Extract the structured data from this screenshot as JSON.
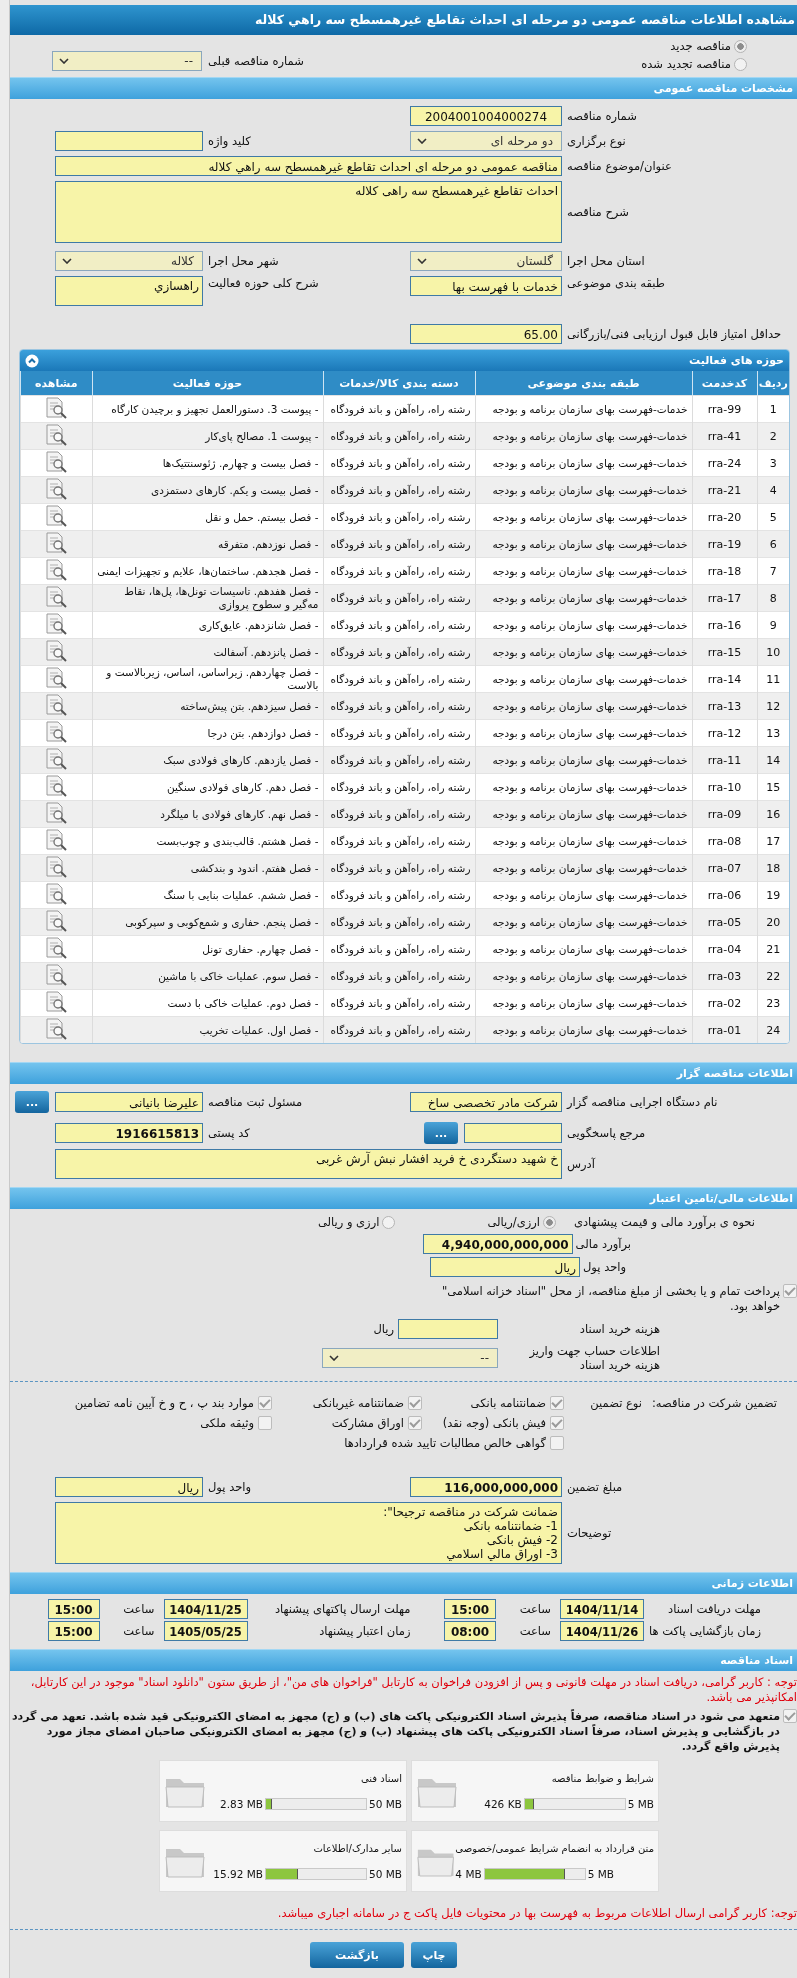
{
  "page_title": "مشاهده اطلاعات مناقصه عمومی دو مرحله ای احداث تقاطع غیرهمسطح سه راهي كلاله",
  "tender_kind": [
    {
      "label": "مناقصه جدید",
      "selected": true
    },
    {
      "label": "مناقصه تجدید شده",
      "selected": false
    }
  ],
  "previous_tender": {
    "label": "شماره مناقصه قبلی",
    "value": "--"
  },
  "general": {
    "heading": "مشخصات مناقصه عمومی",
    "tender_number": {
      "label": "شماره مناقصه",
      "value": "2004001004000274"
    },
    "holding_type": {
      "label": "نوع برگزاری",
      "value": "دو مرحله ای"
    },
    "keyword": {
      "label": "کلید واژه"
    },
    "subject": {
      "label": "عنوان/موضوع مناقصه",
      "value": "مناقصه عمومی دو مرحله ای احداث تقاطع غیرهمسطح سه راهي كلاله"
    },
    "description": {
      "label": "شرح مناقصه",
      "value": "احداث تقاطع غیرهمسطح سه راهی کلاله"
    },
    "province": {
      "label": "استان محل اجرا",
      "value": "گلستان"
    },
    "city": {
      "label": "شهر محل اجرا",
      "value": "کلاله"
    },
    "category": {
      "label": "طبقه بندی موضوعی",
      "value": "خدمات با فهرست بها"
    },
    "activity_scope": {
      "label": "شرح کلی حوزه فعالیت",
      "value": "راهسازي"
    },
    "min_score": {
      "label": "حداقل امتیاز قابل قبول ارزیابی فنی/بازرگانی",
      "value": "65.00"
    }
  },
  "activities": {
    "heading": "حوزه های فعالیت",
    "columns": [
      "ردیف",
      "کدخدمت",
      "طبقه بندی موضوعی",
      "دسته بندی کالا/خدمات",
      "حوزه فعالیت",
      "مشاهده"
    ],
    "rows": [
      {
        "no": "1",
        "code": "rra-99",
        "category": "خدمات-فهرست بهای سازمان برنامه و بودجه",
        "group": "رشته راه، راه‌آهن و باند فرودگاه",
        "activity": "- پیوست 3. دستورالعمل تجهیز و برچیدن کارگاه"
      },
      {
        "no": "2",
        "code": "rra-41",
        "category": "خدمات-فهرست بهای سازمان برنامه و بودجه",
        "group": "رشته راه، راه‌آهن و باند فرودگاه",
        "activity": "- پیوست 1. مصالح پای‌کار"
      },
      {
        "no": "3",
        "code": "rra-24",
        "category": "خدمات-فهرست بهای سازمان برنامه و بودجه",
        "group": "رشته راه، راه‌آهن و باند فرودگاه",
        "activity": "- فصل بیست و چهارم. ژئوسنتتیک‌ها"
      },
      {
        "no": "4",
        "code": "rra-21",
        "category": "خدمات-فهرست بهای سازمان برنامه و بودجه",
        "group": "رشته راه، راه‌آهن و باند فرودگاه",
        "activity": "- فصل بیست و یکم. کارهای دستمزدی"
      },
      {
        "no": "5",
        "code": "rra-20",
        "category": "خدمات-فهرست بهای سازمان برنامه و بودجه",
        "group": "رشته راه، راه‌آهن و باند فرودگاه",
        "activity": "- فصل بیستم. حمل و نقل"
      },
      {
        "no": "6",
        "code": "rra-19",
        "category": "خدمات-فهرست بهای سازمان برنامه و بودجه",
        "group": "رشته راه، راه‌آهن و باند فرودگاه",
        "activity": "- فصل نوزدهم. متفرقه"
      },
      {
        "no": "7",
        "code": "rra-18",
        "category": "خدمات-فهرست بهای سازمان برنامه و بودجه",
        "group": "رشته راه، راه‌آهن و باند فرودگاه",
        "activity": "- فصل هجدهم. ساختمان‌ها، علایم و تجهیزات ایمنی"
      },
      {
        "no": "8",
        "code": "rra-17",
        "category": "خدمات-فهرست بهای سازمان برنامه و بودجه",
        "group": "رشته راه، راه‌آهن و باند فرودگاه",
        "activity": "- فصل هفدهم. تاسیسات تونل‌ها، پل‌ها، نقاط مه‌گیر و سطوح پروازی"
      },
      {
        "no": "9",
        "code": "rra-16",
        "category": "خدمات-فهرست بهای سازمان برنامه و بودجه",
        "group": "رشته راه، راه‌آهن و باند فرودگاه",
        "activity": "- فصل شانزدهم. عایق‌کاری"
      },
      {
        "no": "10",
        "code": "rra-15",
        "category": "خدمات-فهرست بهای سازمان برنامه و بودجه",
        "group": "رشته راه، راه‌آهن و باند فرودگاه",
        "activity": "- فصل پانزدهم. آسفالت"
      },
      {
        "no": "11",
        "code": "rra-14",
        "category": "خدمات-فهرست بهای سازمان برنامه و بودجه",
        "group": "رشته راه، راه‌آهن و باند فرودگاه",
        "activity": "- فصل چهاردهم. زیراساس، اساس، زیربالاست  و بالاست"
      },
      {
        "no": "12",
        "code": "rra-13",
        "category": "خدمات-فهرست بهای سازمان برنامه و بودجه",
        "group": "رشته راه، راه‌آهن و باند فرودگاه",
        "activity": "- فصل سیزدهم. بتن پیش‌ساخته"
      },
      {
        "no": "13",
        "code": "rra-12",
        "category": "خدمات-فهرست بهای سازمان برنامه و بودجه",
        "group": "رشته راه، راه‌آهن و باند فرودگاه",
        "activity": "- فصل دوازدهم. بتن درجا"
      },
      {
        "no": "14",
        "code": "rra-11",
        "category": "خدمات-فهرست بهای سازمان برنامه و بودجه",
        "group": "رشته راه، راه‌آهن و باند فرودگاه",
        "activity": "- فصل یازدهم. کارهای فولادی سبک"
      },
      {
        "no": "15",
        "code": "rra-10",
        "category": "خدمات-فهرست بهای سازمان برنامه و بودجه",
        "group": "رشته راه، راه‌آهن و باند فرودگاه",
        "activity": "- فصل دهم. کارهای فولادی سنگین"
      },
      {
        "no": "16",
        "code": "rra-09",
        "category": "خدمات-فهرست بهای سازمان برنامه و بودجه",
        "group": "رشته راه، راه‌آهن و باند فرودگاه",
        "activity": "- فصل نهم. کارهای فولادی با میلگرد"
      },
      {
        "no": "17",
        "code": "rra-08",
        "category": "خدمات-فهرست بهای سازمان برنامه و بودجه",
        "group": "رشته راه، راه‌آهن و باند فرودگاه",
        "activity": "- فصل هشتم. قالب‌بندی و چوب‌بست"
      },
      {
        "no": "18",
        "code": "rra-07",
        "category": "خدمات-فهرست بهای سازمان برنامه و بودجه",
        "group": "رشته راه، راه‌آهن و باند فرودگاه",
        "activity": "- فصل هفتم. اندود و بندکشی"
      },
      {
        "no": "19",
        "code": "rra-06",
        "category": "خدمات-فهرست بهای سازمان برنامه و بودجه",
        "group": "رشته راه، راه‌آهن و باند فرودگاه",
        "activity": "- فصل ششم. عملیات بنایی با سنگ"
      },
      {
        "no": "20",
        "code": "rra-05",
        "category": "خدمات-فهرست بهای سازمان برنامه و بودجه",
        "group": "رشته راه، راه‌آهن و باند فرودگاه",
        "activity": "- فصل پنجم. حفاری و شمع‌کوبی و سپرکوبی"
      },
      {
        "no": "21",
        "code": "rra-04",
        "category": "خدمات-فهرست بهای سازمان برنامه و بودجه",
        "group": "رشته راه، راه‌آهن و باند فرودگاه",
        "activity": "- فصل چهارم. حفاری تونل"
      },
      {
        "no": "22",
        "code": "rra-03",
        "category": "خدمات-فهرست بهای سازمان برنامه و بودجه",
        "group": "رشته راه، راه‌آهن و باند فرودگاه",
        "activity": "- فصل سوم. عملیات خاکی با ماشین"
      },
      {
        "no": "23",
        "code": "rra-02",
        "category": "خدمات-فهرست بهای سازمان برنامه و بودجه",
        "group": "رشته راه، راه‌آهن و باند فرودگاه",
        "activity": "- فصل دوم. عملیات خاکی با دست"
      },
      {
        "no": "24",
        "code": "rra-01",
        "category": "خدمات-فهرست بهای سازمان برنامه و بودجه",
        "group": "رشته راه، راه‌آهن و باند فرودگاه",
        "activity": "- فصل اول. عملیات تخریب"
      }
    ]
  },
  "employer": {
    "heading": "اطلاعات مناقصه گزار",
    "agency": {
      "label": "نام دستگاه اجرایی مناقصه گزار",
      "value": "شرکت مادر تخصصی ساخ"
    },
    "registrar": {
      "label": "مسئول ثبت مناقصه",
      "value": "علیرضا بانیانی",
      "button": "..."
    },
    "reference": {
      "label": "مرجع پاسخگویی",
      "button": "..."
    },
    "postal_code": {
      "label": "کد پستی",
      "value": "1916615813"
    },
    "address": {
      "label": "آدرس",
      "value": "خ شهید دستگردی خ فرید افشار نبش آرش غربی"
    }
  },
  "finance": {
    "heading": "اطلاعات مالی/تامین اعتبار",
    "pricing": {
      "label": "نحوه ی برآورد مالی و قیمت پیشنهادی",
      "options": [
        {
          "label": "ارزی/ریالی",
          "selected": true
        },
        {
          "label": "ارزی و ریالی",
          "selected": false
        }
      ]
    },
    "estimate": {
      "label": "برآورد مالی",
      "value": "4,940,000,000,000"
    },
    "currency": {
      "label": "واحد پول",
      "value": "ریال"
    },
    "treasury": {
      "label": "پرداخت تمام و یا بخشی از مبلغ مناقصه، از محل \"اسناد خزانه اسلامی\" خواهد بود.",
      "checked": true
    },
    "purchase_cost": {
      "label": "هزینه خرید اسناد",
      "unit": "ریال"
    },
    "account": {
      "label": "اطلاعات حساب جهت واریز هزینه خرید اسناد",
      "value": "--"
    }
  },
  "guarantee": {
    "label": "تضمین شرکت در مناقصه:",
    "type_label": "نوع تضمین",
    "options": [
      {
        "label": "ضمانتنامه بانکی",
        "checked": true
      },
      {
        "label": "ضمانتنامه غیربانکی",
        "checked": true
      },
      {
        "label": "موارد بند پ ، ح و خ آیین نامه تضامین",
        "checked": true
      },
      {
        "label": "فیش بانکی (وجه نقد)",
        "checked": true
      },
      {
        "label": "اوراق مشارکت",
        "checked": true
      },
      {
        "label": "وثیقه ملکی",
        "checked": false
      },
      {
        "label": "گواهی خالص مطالبات تایید شده قراردادها",
        "checked": false
      }
    ],
    "amount": {
      "label": "مبلغ تضمین",
      "value": "116,000,000,000"
    },
    "currency": {
      "label": "واحد پول",
      "value": "ریال"
    },
    "notes": {
      "label": "توضیحات",
      "value": "ضمانت شرکت در مناقصه ترجیحا\":\n1- ضمانتنامه بانکی\n2- فیش بانکی\n3- اوراق مالي اسلامي"
    }
  },
  "timing": {
    "heading": "اطلاعات زمانی",
    "items": [
      {
        "label": "مهلت دریافت اسناد",
        "date": "1404/11/14",
        "time_label": "ساعت",
        "time": "15:00"
      },
      {
        "label": "مهلت ارسال پاکتهای پیشنهاد",
        "date": "1404/11/25",
        "time_label": "ساعت",
        "time": "15:00"
      },
      {
        "label": "زمان بازگشایی پاکت ها",
        "date": "1404/11/26",
        "time_label": "ساعت",
        "time": "08:00"
      },
      {
        "label": "زمان اعتبار پیشنهاد",
        "date": "1405/05/25",
        "time_label": "ساعت",
        "time": "15:00"
      }
    ]
  },
  "documents": {
    "heading": "اسناد مناقصه",
    "notice": "توجه : کاربر گرامی، دریافت اسناد در مهلت قانونی و پس از افزودن فراخوان به کارتابل \"فراخوان های من\"، از طریق ستون \"دانلود اسناد\" موجود در این کارتابل، امکانپذیر می باشد.",
    "commitment": {
      "text": "متعهد می شود در اسناد مناقصه، صرفاً پذیرش اسناد الکترونیکی پاکت های (ب) و (ج) مجهز به امضای الکترونیکی قید شده باشد. تعهد می گردد در بازگشایی و پذیرش اسناد، صرفاً اسناد الکترونیکی پاکت های پیشنهاد (ب) و (ج) مجهز به امضای الکترونیکی صاحبان امضای مجاز مورد پذیرش واقع گردد.",
      "checked": true
    },
    "files": [
      {
        "name": "شرایط و ضوابط مناقصه",
        "size": "426 KB",
        "max": "5 MB",
        "level": 0.09
      },
      {
        "name": "اسناد فنی",
        "size": "2.83 MB",
        "max": "50 MB",
        "level": 0.06
      },
      {
        "name": "متن قرارداد به انضمام شرایط عمومی/خصوصی",
        "size": "4 MB",
        "max": "5 MB",
        "level": 0.8
      },
      {
        "name": "سایر مدارک/اطلاعات",
        "size": "15.92 MB",
        "max": "50 MB",
        "level": 0.32
      }
    ],
    "note": "توجه: کاربر گرامی ارسال اطلاعات مربوط به فهرست بها در محتویات فایل پاکت ج در سامانه اجباری میباشد."
  },
  "buttons": [
    "چاپ",
    "بازگشت"
  ]
}
